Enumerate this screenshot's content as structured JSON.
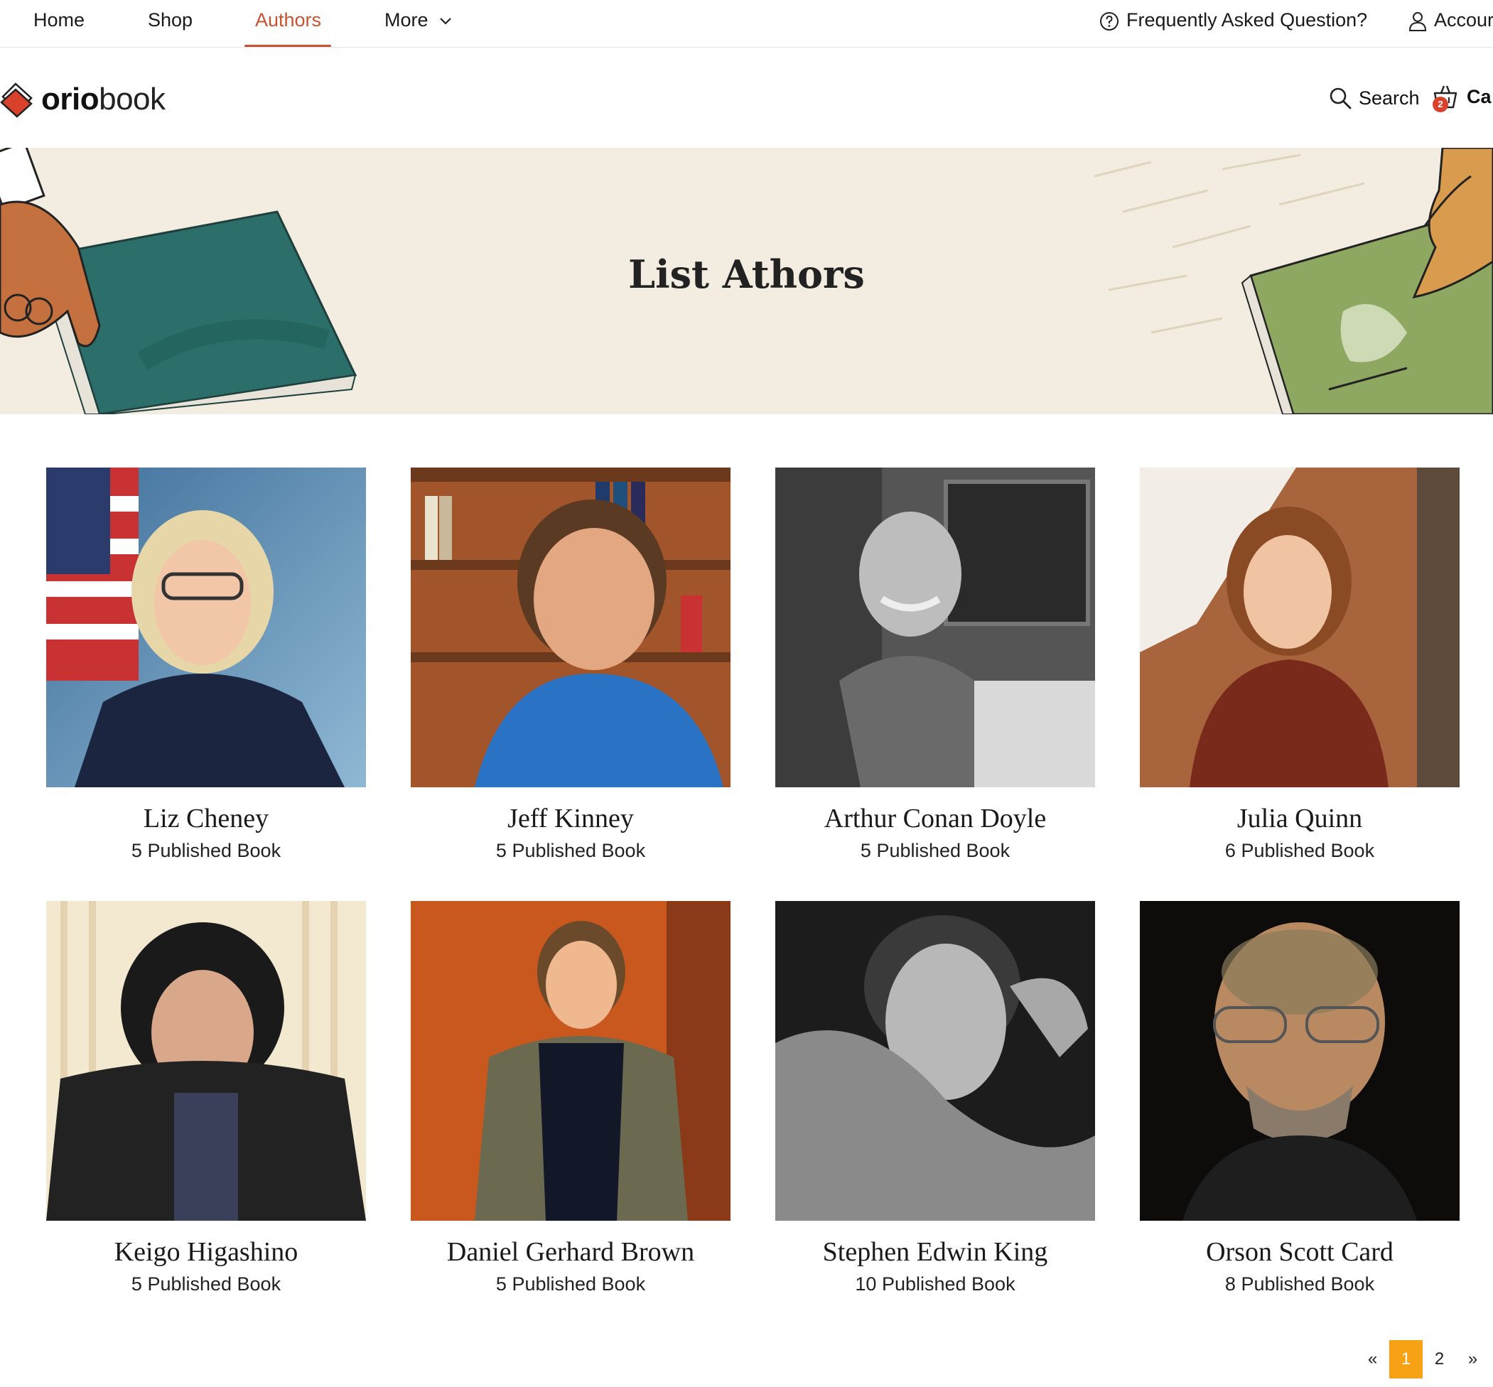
{
  "topnav": {
    "items": [
      {
        "label": "Home"
      },
      {
        "label": "Shop"
      },
      {
        "label": "Authors",
        "active": true
      },
      {
        "label": "More"
      }
    ],
    "faq_label": "Frequently Asked Question?",
    "account_label": "Accour"
  },
  "header": {
    "logo_bold": "orio",
    "logo_light": "book",
    "search_label": "Search",
    "cart_label": "Ca",
    "cart_count": "2"
  },
  "banner": {
    "title": "List Athors"
  },
  "authors": [
    {
      "name": "Liz Cheney",
      "books": "5 Published Book"
    },
    {
      "name": "Jeff Kinney",
      "books": "5 Published Book"
    },
    {
      "name": "Arthur Conan Doyle",
      "books": "5 Published Book"
    },
    {
      "name": "Julia Quinn",
      "books": "6 Published Book"
    },
    {
      "name": "Keigo Higashino",
      "books": "5 Published Book"
    },
    {
      "name": "Daniel Gerhard Brown",
      "books": "5 Published Book"
    },
    {
      "name": "Stephen Edwin King",
      "books": "10 Published Book"
    },
    {
      "name": "Orson Scott Card",
      "books": "8 Published Book"
    }
  ],
  "pagination": {
    "prev": "«",
    "pages": [
      "1",
      "2"
    ],
    "current": "1",
    "next": "»"
  },
  "colors": {
    "accent": "#c7522f",
    "page_active": "#f7a114",
    "banner_bg": "#f3ede1",
    "cart_badge": "#d9412b"
  }
}
